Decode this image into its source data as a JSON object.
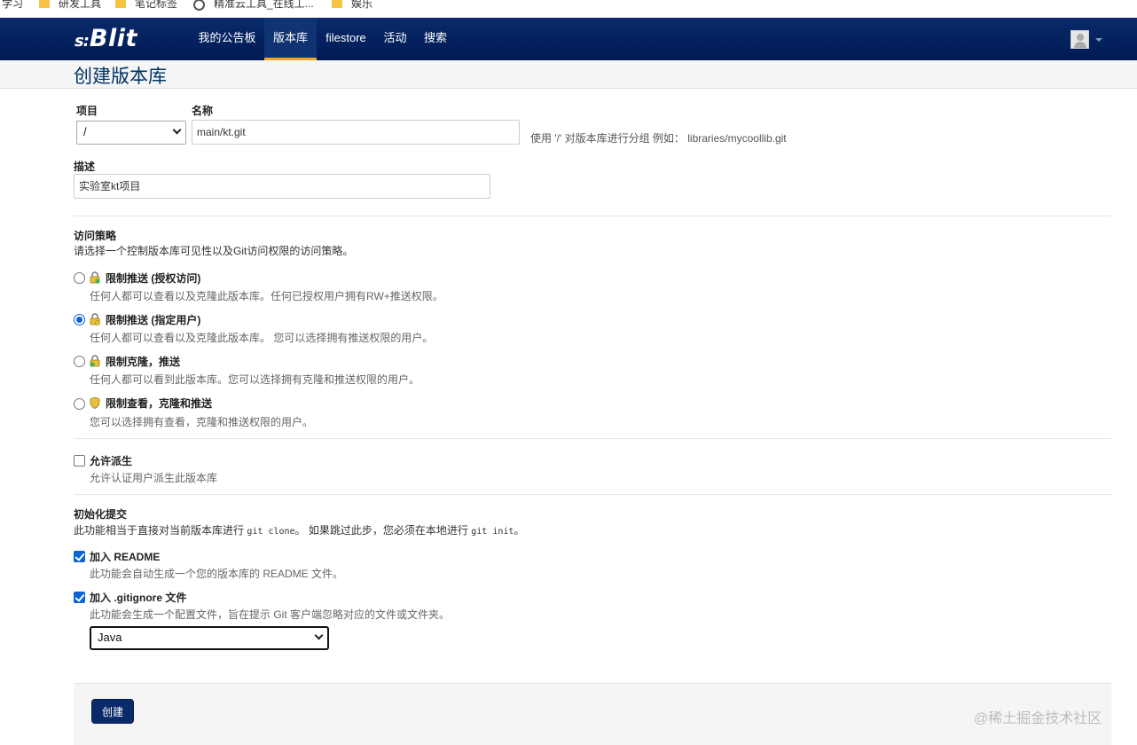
{
  "bookmarks": [
    {
      "label": "学习",
      "icon": "none"
    },
    {
      "label": "研发工具",
      "icon": "folder-icon"
    },
    {
      "label": "笔记标签",
      "icon": "folder-icon"
    },
    {
      "label": "精准云工具_在线工...",
      "icon": "globe-icon"
    },
    {
      "label": "娱乐",
      "icon": "folder-icon"
    }
  ],
  "navbar": {
    "brand_prefix": "s:",
    "brand": "Blit",
    "items": [
      "我的公告板",
      "版本库",
      "filestore",
      "活动",
      "搜索"
    ],
    "active_item": "版本库"
  },
  "page": {
    "title": "创建版本库"
  },
  "form": {
    "project_label": "项目",
    "project_value": "/",
    "name_label": "名称",
    "name_value": "main/kt.git",
    "name_hint": "使用 '/' 对版本库进行分组 例如： libraries/mycoollib.git",
    "description_label": "描述",
    "description_value": "实验室kt项目",
    "access": {
      "title": "访问策略",
      "help": "请选择一个控制版本库可见性以及Git访问权限的访问策略。",
      "options": [
        {
          "title": "限制推送 (授权访问)",
          "desc": "任何人都可以查看以及克隆此版本库。任何已授权用户拥有RW+推送权限。",
          "checked": false,
          "icon": "lock-icon"
        },
        {
          "title": "限制推送 (指定用户)",
          "desc": "任何人都可以查看以及克隆此版本库。 您可以选择拥有推送权限的用户。",
          "checked": true,
          "icon": "lock-icon"
        },
        {
          "title": "限制克隆，推送",
          "desc": "任何人都可以看到此版本库。您可以选择拥有克隆和推送权限的用户。",
          "checked": false,
          "icon": "lock-icon"
        },
        {
          "title": "限制查看，克隆和推送",
          "desc": "您可以选择拥有查看，克隆和推送权限的用户。",
          "checked": false,
          "icon": "shield-icon"
        }
      ]
    },
    "fork": {
      "title": "允许派生",
      "desc": "允许认证用户派生此版本库",
      "checked": false
    },
    "init": {
      "title": "初始化提交",
      "help_prefix": "此功能相当于直接对当前版本库进行",
      "help_code1": "git clone",
      "help_mid": "。 如果跳过此步，您必须在本地进行",
      "help_code2": "git init",
      "help_suffix": "。",
      "readme_title": "加入 README",
      "readme_desc": "此功能会自动生成一个您的版本库的 README 文件。",
      "readme_checked": true,
      "gitignore_title": "加入 .gitignore 文件",
      "gitignore_desc": "此功能会生成一个配置文件，旨在提示 Git 客户端忽略对应的文件或文件夹。",
      "gitignore_checked": true,
      "gitignore_select": "Java"
    },
    "create_button": "创建"
  },
  "watermark": "@稀土掘金技术社区",
  "colors": {
    "navbar": "#002060",
    "accent": "#f5a623",
    "primary_button": "#0a2a6a"
  }
}
